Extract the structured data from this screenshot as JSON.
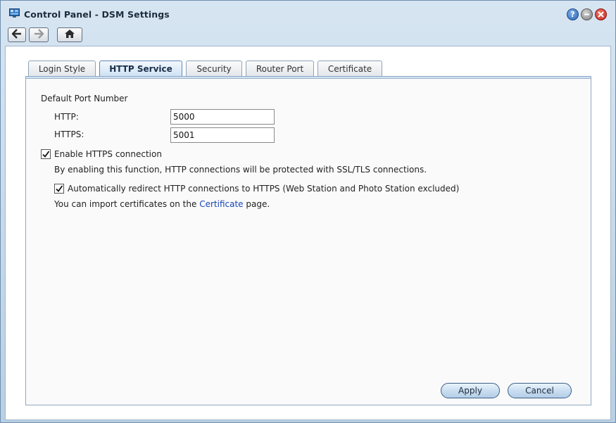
{
  "window": {
    "title": "Control Panel - DSM Settings",
    "controls": [
      "help-icon",
      "minimize-icon",
      "close-icon"
    ],
    "colors": {
      "accent": "#2a62b0",
      "close": "#c3231a"
    }
  },
  "nav": {
    "icons": [
      "back-arrow-icon",
      "forward-arrow-icon",
      "home-icon"
    ]
  },
  "tabs": [
    {
      "label": "Login Style",
      "active": false
    },
    {
      "label": "HTTP Service",
      "active": true
    },
    {
      "label": "Security",
      "active": false
    },
    {
      "label": "Router Port",
      "active": false
    },
    {
      "label": "Certificate",
      "active": false
    }
  ],
  "form": {
    "section_title": "Default Port Number",
    "http_label": "HTTP:",
    "http_value": "5000",
    "https_label": "HTTPS:",
    "https_value": "5001",
    "enable_https": {
      "label": "Enable HTTPS connection",
      "checked": true,
      "description": "By enabling this function, HTTP connections will be protected with SSL/TLS connections."
    },
    "redirect": {
      "label": "Automatically redirect HTTP connections to HTTPS (Web Station and Photo Station excluded)",
      "checked": true
    },
    "certificate_note": {
      "prefix": "You can import certificates on the ",
      "link": "Certificate",
      "suffix": " page."
    }
  },
  "buttons": {
    "apply": "Apply",
    "cancel": "Cancel"
  }
}
